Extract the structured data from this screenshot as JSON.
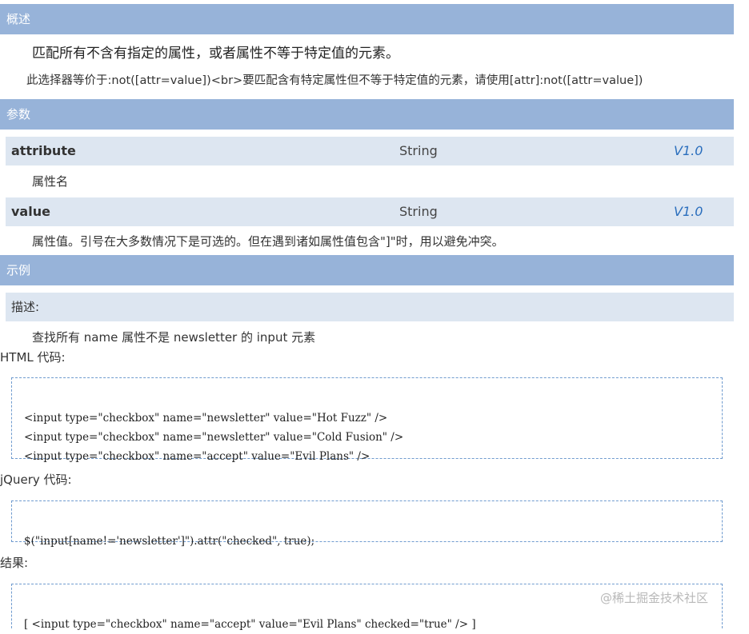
{
  "sections": {
    "overview": "概述",
    "params": "参数",
    "examples": "示例"
  },
  "overview": {
    "summary": "匹配所有不含有指定的属性，或者属性不等于特定值的元素。",
    "note": "此选择器等价于:not([attr=value])<br>要匹配含有特定属性但不等于特定值的元素，请使用[attr]:not([attr=value])"
  },
  "params": [
    {
      "name": "attribute",
      "type": "String",
      "version": "V1.0",
      "desc": "属性名"
    },
    {
      "name": "value",
      "type": "String",
      "version": "V1.0",
      "desc": "属性值。引号在大多数情况下是可选的。但在遇到诸如属性值包含\"]\"时，用以避免冲突。"
    }
  ],
  "example": {
    "desc_label": "描述:",
    "desc_text": "查找所有 name 属性不是 newsletter 的 input 元素",
    "html_label": "HTML 代码:",
    "html_code": [
      "<input type=\"checkbox\" name=\"newsletter\" value=\"Hot Fuzz\" />",
      "<input type=\"checkbox\" name=\"newsletter\" value=\"Cold Fusion\" />",
      "<input type=\"checkbox\" name=\"accept\" value=\"Evil Plans\" />"
    ],
    "jquery_label": "jQuery 代码:",
    "jquery_code": "$(\"input[name!='newsletter']\").attr(\"checked\", true);",
    "result_label": "结果:",
    "result_code": "[ <input type=\"checkbox\" name=\"accept\" value=\"Evil Plans\" checked=\"true\" /> ]"
  },
  "watermark": "@稀土掘金技术社区"
}
